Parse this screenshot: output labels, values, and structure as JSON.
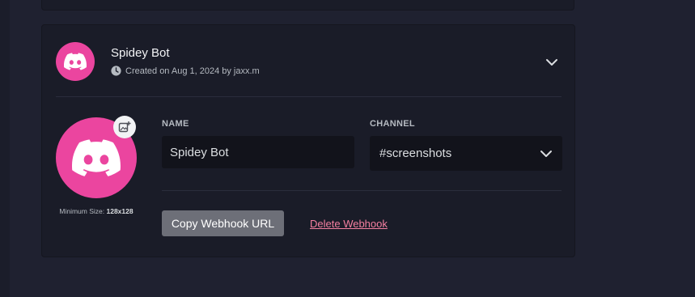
{
  "webhook": {
    "title": "Spidey Bot",
    "created_text": "Created on Aug 1, 2024 by jaxx.m",
    "min_size_label": "Minimum Size:",
    "min_size_value": "128x128"
  },
  "form": {
    "name_label": "NAME",
    "name_value": "Spidey Bot",
    "channel_label": "CHANNEL",
    "channel_value": "#screenshots"
  },
  "actions": {
    "copy_label": "Copy Webhook URL",
    "delete_label": "Delete Webhook"
  },
  "icons": {
    "avatar": "discord-logo-icon",
    "clock": "clock-icon",
    "collapse": "chevron-down-icon",
    "upload": "image-upload-icon",
    "select": "chevron-down-icon"
  },
  "colors": {
    "brand_pink": "#eb459f",
    "background": "#1f2130",
    "card": "#1a1c28",
    "input": "#12131b",
    "link_pink": "#f47fa0",
    "button_gray": "#6d6f78"
  }
}
